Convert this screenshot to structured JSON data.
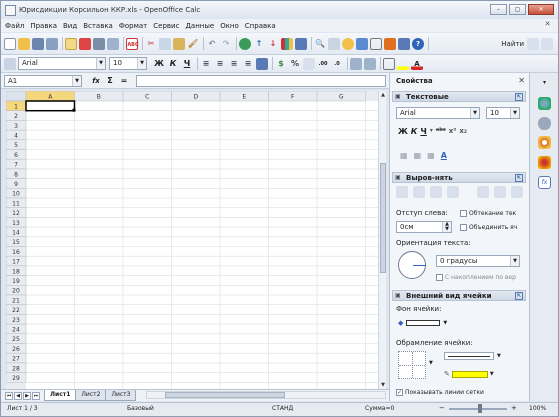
{
  "window": {
    "title": "Юрисдикции Корсильон ККР.xls - OpenOffice Calc"
  },
  "menu": [
    "Файл",
    "Правка",
    "Вид",
    "Вставка",
    "Формат",
    "Сервис",
    "Данные",
    "Окно",
    "Справка"
  ],
  "toolbar": {
    "find_label": "Найти"
  },
  "formatting": {
    "font": "Arial",
    "size": "10",
    "bold": "Ж",
    "italic": "К",
    "underline": "Ч"
  },
  "formula_bar": {
    "name_box": "A1",
    "fx": "fx",
    "sum": "Σ",
    "equals": "="
  },
  "grid": {
    "columns": [
      "A",
      "B",
      "C",
      "D",
      "E",
      "F",
      "G"
    ],
    "rows": [
      "1",
      "2",
      "3",
      "4",
      "5",
      "6",
      "7",
      "8",
      "9",
      "10",
      "11",
      "12",
      "13",
      "14",
      "15",
      "16",
      "17",
      "18",
      "19",
      "20",
      "21",
      "22",
      "23",
      "24",
      "25",
      "26",
      "27",
      "28",
      "29"
    ],
    "selected_cell": "A1"
  },
  "sheets": [
    "Лист1",
    "Лист2",
    "Лист3"
  ],
  "active_sheet": "Лист1",
  "status": {
    "sheet": "Лист 1 / 3",
    "style": "Базовый",
    "mode": "СТАНД",
    "sum": "Сумма=0",
    "zoom": "100%"
  },
  "sidebar": {
    "title": "Свойства",
    "text_panel": {
      "title": "Текстовые",
      "font": "Arial",
      "size": "10",
      "bold": "Ж",
      "italic": "К",
      "underline": "Ч"
    },
    "align_panel": {
      "title": "Выров-нять",
      "indent_label": "Отступ слева:",
      "indent_value": "0см",
      "wrap_label": "Обтекание тек",
      "merge_label": "Объединить яч",
      "orientation_label": "Ориентация текста:",
      "orientation_value": "0 градусы",
      "stack_label": "С накоплением по вер"
    },
    "cell_panel": {
      "title": "Внешний вид ячейки",
      "bg_label": "Фон ячейки:",
      "border_label": "Обрамление ячейки:",
      "gridlines_label": "Показывать линии сетки"
    }
  },
  "colors": {
    "accent": "#2f64b8",
    "grid_line": "#d9dde3",
    "header_bg": "#e8ecf1",
    "selected_header": "#f5d77e",
    "highlight": "#ffff00"
  }
}
